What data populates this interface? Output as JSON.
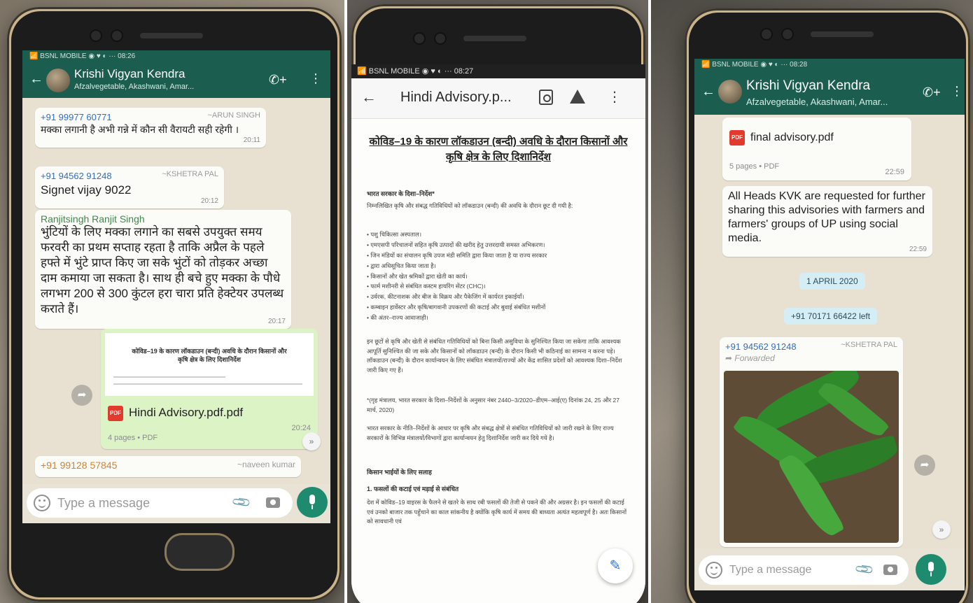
{
  "left_phone": {
    "status": "📶 BSNL MOBILE ◉ ♥ ◐ ··· 08:26",
    "chat_title": "Krishi Vigyan Kendra",
    "chat_subtitle": "Afzalvegetable, Akashwani, Amar...",
    "messages": [
      {
        "phone": "+91 99977 60771",
        "name": "~ARUN SINGH",
        "text": "मक्का लगानी है अभी गन्ने में कौन सी वैरायटी सही रहेगी ।",
        "time": "20:11"
      },
      {
        "phone": "+91 94562 91248",
        "name": "~KSHETRA PAL",
        "text": "Signet vijay 9022",
        "time": "20:12"
      },
      {
        "name": "Ranjitsingh Ranjit Singh",
        "text": "भुंटियों के लिए मक्का लगाने का सबसे उपयुक्त समय फरवरी का प्रथम सप्ताह रहता है ताकि अप्रैल के पहले हफ्ते में भुंटे प्राप्त किए जा सके भुंटों को तोड़कर अच्छा दाम कमाया जा सकता है। साथ ही बचे हुए मक्का के पौधे लगभग 200 से 300 कुंटल हरा चारा प्रति हेक्टेयर उपलब्ध कराते हैं।",
        "time": "20:17"
      }
    ],
    "pdf": {
      "preview_title": "कोविड–19 के कारण लॉकडाउन (बन्दी) अवधि के दौरान किसानों और कृषि क्षेत्र के लिए दिशानिर्देश",
      "badge": "PDF",
      "name": "Hindi Advisory.pdf.pdf",
      "meta": "4 pages • PDF",
      "time": "20:24"
    },
    "last_sender": {
      "phone": "+91 99128 57845",
      "name": "~naveen kumar"
    },
    "input_placeholder": "Type a message"
  },
  "middle_phone": {
    "status": "📶 BSNL MOBILE ◉ ♥ ◐ ··· 08:27",
    "doc_title": "Hindi Advisory.p...",
    "heading": "कोविड–19 के कारण लॉकडाउन (बन्दी) अवधि के दौरान किसानों और कृषि क्षेत्र के लिए दिशानिर्देश",
    "subhead_1": "भारत सरकार के दिशा–निर्देश*",
    "intro": "निम्नलिखित कृषि और संबद्ध गतिविधियों को लॉकडाउन (बन्दी) की अवधि के दौरान छूट दी गयी है:",
    "bullets": [
      "पशु चिकित्सा अस्पताल।",
      "एमएसपी परिचालनों सहित कृषि उत्पादों की खरीद हेतु उत्तरदायी समस्त अभिकरण।",
      "जिन मंडियों का संचालन कृषि उपज मंडी समिति द्वारा किया जाता है या राज्य सरकार",
      "द्वारा अधिसूचित किया जाता है।",
      "किसानों और खेत श्रमिकों द्वारा खेती का कार्य।",
      "फार्म मशीनरी से संबंधित कस्टम हायरिंग सेंटर (CHC)।",
      "उर्वरक, कीटनाशक और बीज के विक्रय और पैकेजिंग में कार्यरत इकाईयाँ।",
      "कम्बाइन हार्वेस्टर और कृषि/बागवानी उपकरणों की कटाई और बुवाई संबंधित मशीनों",
      "की अंतर–राज्य आवाजाही।"
    ],
    "para_2": "इन छूटों से कृषि और खेती से संबंधित गतिविधियों को बिना किसी असुविधा के सुनिश्चित किया जा सकेगा ताकि आवश्यक आपूर्ति सुनिश्चित की जा सके और किसानों को लॉकडाउन (बन्दी) के दौरान किसी भी कठिनाई का सामना न करना पड़े। लॉकडाउन (बन्दी) के दौरान कार्यान्वयन के लिए संबंधित मंत्रालयों/राज्यों और केंद्र शासित प्रदेशों को आवश्यक दिशा–निर्देश जारी किए गए हैं।",
    "para_3": "*(गृह मंत्रालय, भारत सरकार के दिशा–निर्देशों के अनुसार नंबर 2440–3/2020–डीएम–आई(ए) दिनांक 24, 25 और 27 मार्च, 2020)",
    "para_4": "भारत सरकार के नीति–निर्देशों के आधार पर कृषि और संबद्ध क्षेत्रों से संबंधित गतिविधियों को जारी रखने के लिए राज्य सरकारों के विभिन्न मंत्रालयों/विभागों द्वारा कार्यान्वयन हेतु दिशानिर्देश जारी कर दिये गये है।",
    "subhead_2": "किसान भाईयों के लिए सलाह",
    "subhead_3": "1. फसलों की कटाई एवं मड़ाई से संबंधित",
    "para_5": "देश में कोविड–19 वाइरस के फैलने से खतरे के साथ रबी फसलों की तेजी से पकने की और अग्रसर है। इन फसलों की कटाई एवं उनको बाजार तक पहुँचाने का काल सांकनीय है क्योंकि कृषि कार्य में समय की बाध्यता अत्यंत महत्वपूर्ण है। अतः किसानों को सावधानी एवं"
  },
  "right_phone": {
    "status": "📶 BSNL MOBILE ◉ ♥ ◐ ··· 08:28",
    "chat_title": "Krishi Vigyan Kendra",
    "chat_subtitle": "Afzalvegetable, Akashwani, Amar...",
    "pdf": {
      "badge": "PDF",
      "name": "final advisory.pdf",
      "meta": "5 pages • PDF",
      "time": "22:59"
    },
    "message": {
      "text": "All Heads KVK are requested for further sharing this advisories with farmers and farmers' groups of UP using social media.",
      "time": "22:59"
    },
    "date_chip": "1 APRIL 2020",
    "system_chip": "+91 70171 66422 left",
    "forwarded": {
      "phone": "+91 94562 91248",
      "name": "~KSHETRA PAL",
      "label": "Forwarded"
    },
    "input_placeholder": "Type a message"
  }
}
